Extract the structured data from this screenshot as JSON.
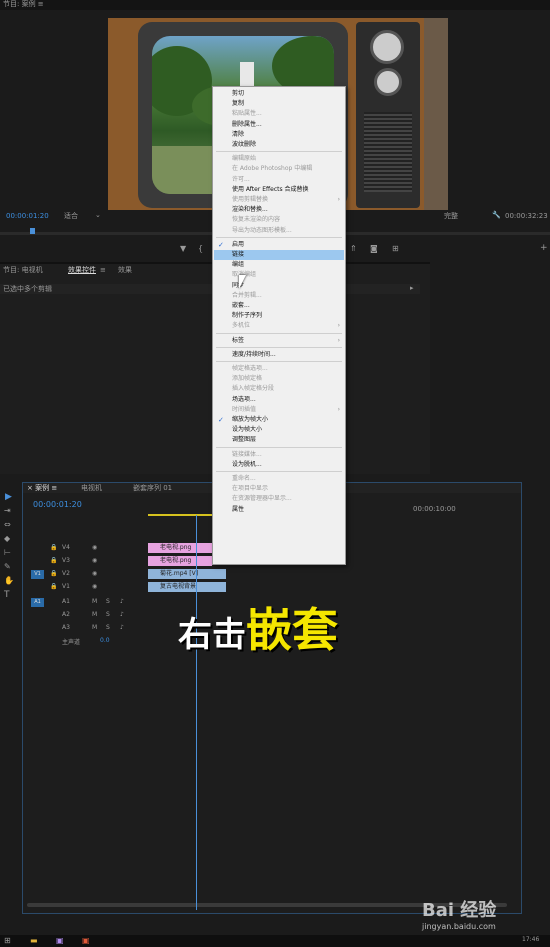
{
  "program": {
    "title": "节目: 案例 ≡",
    "timecode_left": "00:00:01:20",
    "fit_label": "适合",
    "quality_label": "完整",
    "timecode_right": "00:00:32:23"
  },
  "effects_panel": {
    "tabs": [
      "节目: 电视机",
      "效果控件",
      "≡",
      "效果"
    ],
    "subheader": "已选中多个剪辑"
  },
  "timeline": {
    "tabs": [
      "× 案例 ≡",
      "电视机",
      "嵌套序列 01"
    ],
    "timecode": "00:00:01:20",
    "ruler_mark": "00:00:10:00",
    "video_tracks": [
      {
        "name": "V4"
      },
      {
        "name": "V3"
      },
      {
        "name": "V2"
      },
      {
        "name": "V1"
      }
    ],
    "audio_tracks": [
      {
        "name": "A1",
        "m": "M",
        "s": "S"
      },
      {
        "name": "A2",
        "m": "M",
        "s": "S"
      },
      {
        "name": "A3",
        "m": "M",
        "s": "S"
      }
    ],
    "master_label": "主声道",
    "master_value": "0.0",
    "side_labels": {
      "v1": "V1",
      "a1": "A1"
    },
    "clips": [
      {
        "label": "老电视.png",
        "color": "#e7a3e0"
      },
      {
        "label": "老电视.png",
        "color": "#e7a3e0"
      },
      {
        "label": "菊花.mp4 [V]",
        "color": "#8fb4d9"
      },
      {
        "label": "复古电视背景",
        "color": "#8fb4d9"
      }
    ]
  },
  "context_menu": {
    "items": [
      {
        "label": "剪切",
        "enabled": true
      },
      {
        "label": "复制",
        "enabled": true
      },
      {
        "label": "粘贴属性...",
        "enabled": false
      },
      {
        "label": "删除属性...",
        "enabled": true
      },
      {
        "label": "清除",
        "enabled": true
      },
      {
        "label": "波纹删除",
        "enabled": true
      },
      {
        "sep": true
      },
      {
        "label": "编辑原始",
        "enabled": false
      },
      {
        "label": "在 Adobe Photoshop 中编辑",
        "enabled": false
      },
      {
        "label": "许可...",
        "enabled": false
      },
      {
        "label": "使用 After Effects 合成替换",
        "enabled": true
      },
      {
        "label": "使用剪辑替换",
        "enabled": false,
        "submenu": true
      },
      {
        "label": "渲染和替换...",
        "enabled": true
      },
      {
        "label": "恢复未渲染的内容",
        "enabled": false
      },
      {
        "label": "导出为动态图形模板...",
        "enabled": false
      },
      {
        "sep": true
      },
      {
        "label": "启用",
        "enabled": true,
        "checked": true
      },
      {
        "label": "链接",
        "enabled": true,
        "highlighted": true
      },
      {
        "label": "编组",
        "enabled": true
      },
      {
        "label": "取消编组",
        "enabled": false
      },
      {
        "label": "同步",
        "enabled": true
      },
      {
        "label": "合并剪辑...",
        "enabled": false
      },
      {
        "label": "嵌套...",
        "enabled": true
      },
      {
        "label": "制作子序列",
        "enabled": true
      },
      {
        "label": "多机位",
        "enabled": false,
        "submenu": true
      },
      {
        "sep": true
      },
      {
        "label": "标签",
        "enabled": true,
        "submenu": true
      },
      {
        "sep": true
      },
      {
        "label": "速度/持续时间...",
        "enabled": true
      },
      {
        "sep": true
      },
      {
        "label": "帧定格选项...",
        "enabled": false
      },
      {
        "label": "添加帧定格",
        "enabled": false
      },
      {
        "label": "插入帧定格分段",
        "enabled": false
      },
      {
        "label": "场选项...",
        "enabled": true
      },
      {
        "label": "时间插值",
        "enabled": false,
        "submenu": true
      },
      {
        "label": "缩放为帧大小",
        "enabled": true,
        "checked": true
      },
      {
        "label": "设为帧大小",
        "enabled": true
      },
      {
        "label": "调整图层",
        "enabled": true
      },
      {
        "sep": true
      },
      {
        "label": "链接媒体...",
        "enabled": false
      },
      {
        "label": "设为脱机...",
        "enabled": true
      },
      {
        "sep": true
      },
      {
        "label": "重命名...",
        "enabled": false
      },
      {
        "label": "在项目中显示",
        "enabled": false
      },
      {
        "label": "在资源管理器中显示...",
        "enabled": false
      },
      {
        "label": "属性",
        "enabled": true
      }
    ]
  },
  "caption": {
    "part1": "右击",
    "part2": "嵌套",
    "color1": "#ffffff",
    "color2": "#f5e600"
  },
  "watermark": {
    "text": "Bai 经验",
    "sub": "jingyan.baidu.com"
  },
  "taskbar": {
    "time": "17:46"
  }
}
